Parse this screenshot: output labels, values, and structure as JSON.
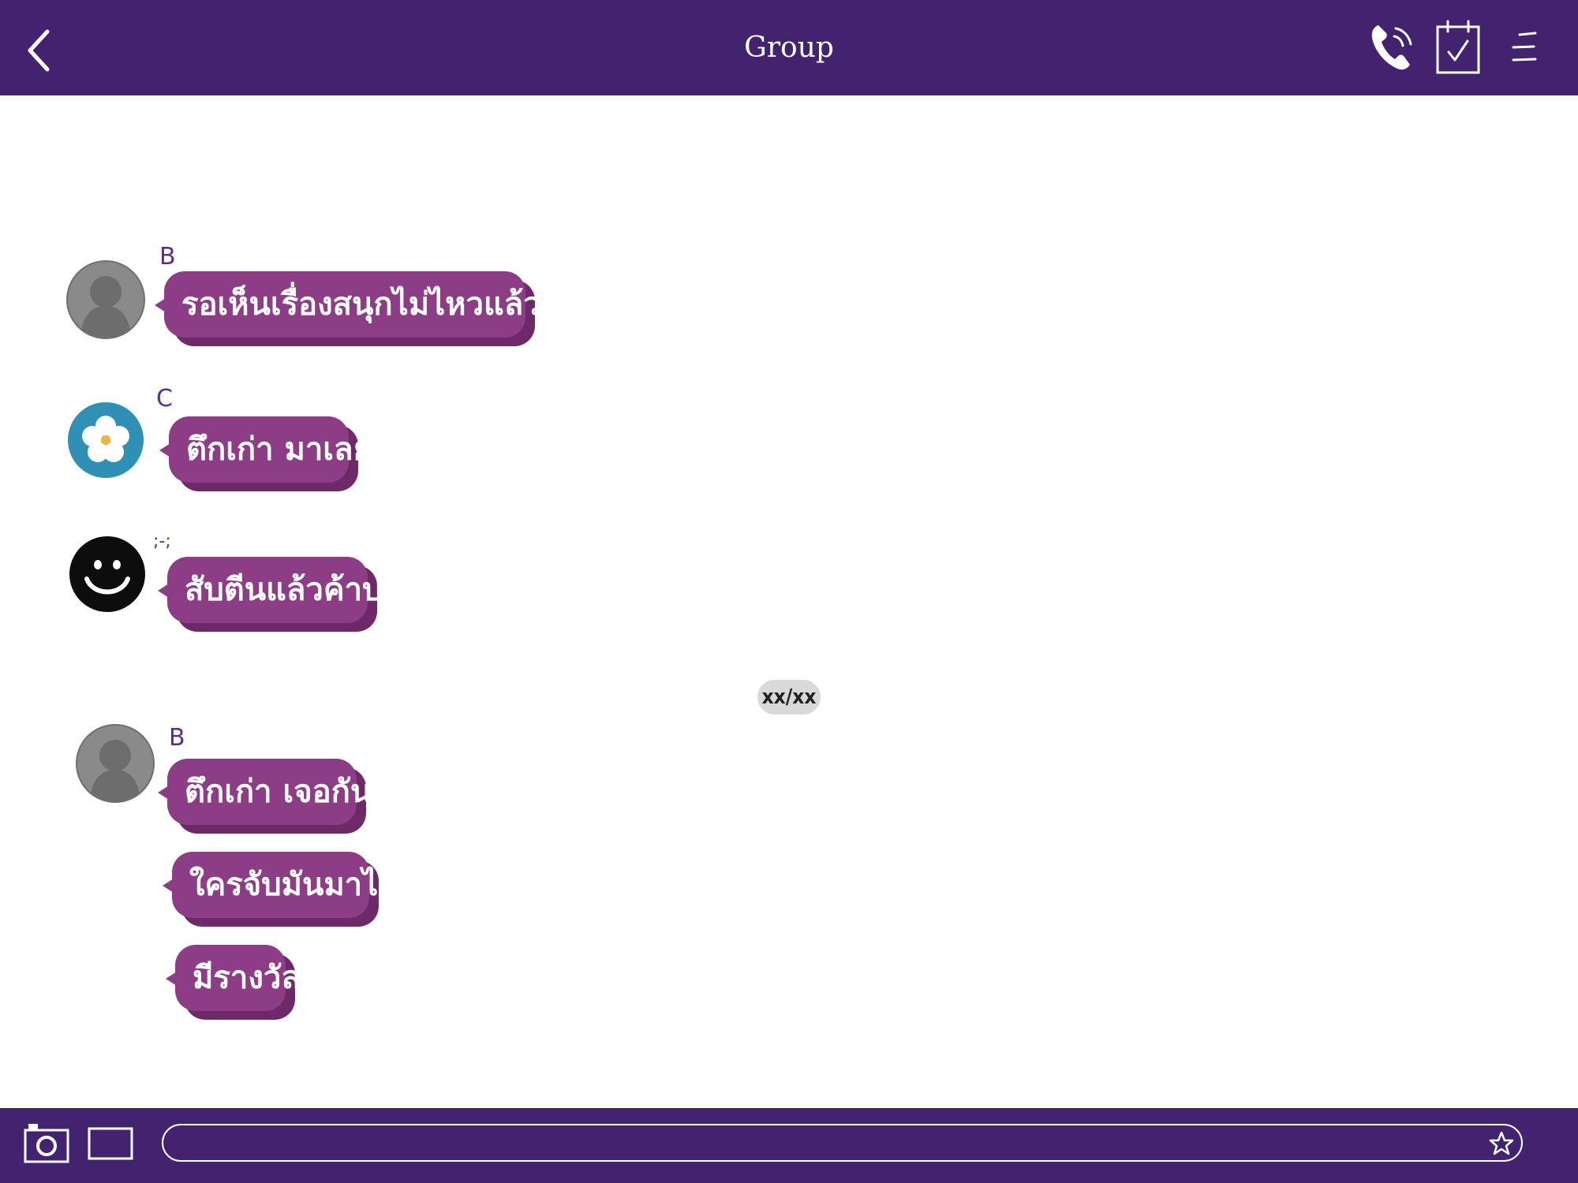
{
  "header": {
    "title": "Group",
    "icons": [
      "chevron-left-icon",
      "phone-icon",
      "calendar-check-icon",
      "menu-icon"
    ]
  },
  "messages": [
    {
      "sender": "B",
      "avatar": "default-person-avatar",
      "text": "รอเห็นเรื่องสนุกไม่ไหวแล้วค่า"
    },
    {
      "sender": "C",
      "avatar": "flower-avatar",
      "text": "ตึกเก่า มาเลย"
    },
    {
      "sender": ";-;",
      "avatar": "smiley-avatar",
      "text": "สับตีนแล้วค้าบ"
    }
  ],
  "date_divider": "xx/xx",
  "group_b": {
    "sender": "B",
    "avatar": "default-person-avatar",
    "messages": [
      "ตึกเก่า เจอกัน",
      "ใครจับมันมาได้",
      "มีรางวัล"
    ]
  },
  "composer": {
    "placeholder": "",
    "icons": [
      "camera-icon",
      "image-icon",
      "star-icon"
    ]
  },
  "colors": {
    "bar": "#43226f",
    "bubble": "#8c3d85",
    "bubble_shadow": "#6e2a68",
    "sender_text": "#5a2f8a"
  }
}
